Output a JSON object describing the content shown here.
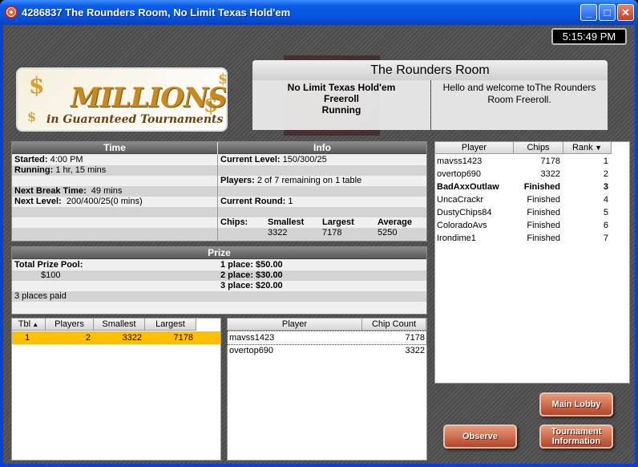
{
  "window": {
    "title": "4286837 The Rounders Room, No Limit Texas Hold'em"
  },
  "clock": "5:15:49 PM",
  "banner": {
    "line1": "MILLIONS",
    "line2": "in Guaranteed Tournaments"
  },
  "room": {
    "name": "The Rounders Room",
    "game": "No Limit Texas Hold'em",
    "type": "Freeroll",
    "status": "Running",
    "welcome": "Hello and welcome toThe Rounders Room Freeroll."
  },
  "time_panel": {
    "header": "Time",
    "started_label": "Started:",
    "started": "4:00 PM",
    "running_label": "Running:",
    "running": "1 hr, 15 mins",
    "break_label": "Next Break Time:",
    "break": "49 mins",
    "next_level_label": "Next Level:",
    "next_level": "200/400/25(0 mins)"
  },
  "info_panel": {
    "header": "Info",
    "level_label": "Current Level:",
    "level": "150/300/25",
    "players_label": "Players:",
    "players": "2 of 7 remaining on 1 table",
    "round_label": "Current Round:",
    "round": "1",
    "chips_label": "Chips:",
    "smallest_label": "Smallest",
    "largest_label": "Largest",
    "average_label": "Average",
    "smallest": "3322",
    "largest": "7178",
    "average": "5250"
  },
  "prize_panel": {
    "header": "Prize",
    "pool_label": "Total Prize Pool:",
    "pool": "$100",
    "places_paid": "3 places paid",
    "places": [
      {
        "label": "1 place:",
        "amount": "$50.00"
      },
      {
        "label": "2 place:",
        "amount": "$30.00"
      },
      {
        "label": "3 place:",
        "amount": "$20.00"
      }
    ]
  },
  "tables": {
    "columns": [
      "Tbl",
      "Players",
      "Smallest",
      "Largest"
    ],
    "rows": [
      {
        "tbl": "1",
        "players": "2",
        "smallest": "3322",
        "largest": "7178"
      }
    ]
  },
  "table_players": {
    "columns": [
      "Player",
      "Chip Count"
    ],
    "rows": [
      {
        "player": "mavss1423",
        "chips": "7178"
      },
      {
        "player": "overtop690",
        "chips": "3322"
      }
    ]
  },
  "standings": {
    "columns": [
      "Player",
      "Chips",
      "Rank"
    ],
    "rows": [
      {
        "player": "mavss1423",
        "chips": "7178",
        "rank": "1"
      },
      {
        "player": "overtop690",
        "chips": "3322",
        "rank": "2"
      },
      {
        "player": "BadAxxOutlaw",
        "chips": "Finished",
        "rank": "3"
      },
      {
        "player": "UncaCrackr",
        "chips": "Finished",
        "rank": "4"
      },
      {
        "player": "DustyChips84",
        "chips": "Finished",
        "rank": "5"
      },
      {
        "player": "ColoradoAvs",
        "chips": "Finished",
        "rank": "6"
      },
      {
        "player": "Irondime1",
        "chips": "Finished",
        "rank": "7"
      }
    ]
  },
  "buttons": {
    "main_lobby": "Main Lobby",
    "observe": "Observe",
    "tournament_info_1": "Tournament",
    "tournament_info_2": "Information"
  },
  "colors": {
    "title_bar": "#0554e0",
    "selected_row": "#ffc000",
    "button": "#b4462a"
  }
}
